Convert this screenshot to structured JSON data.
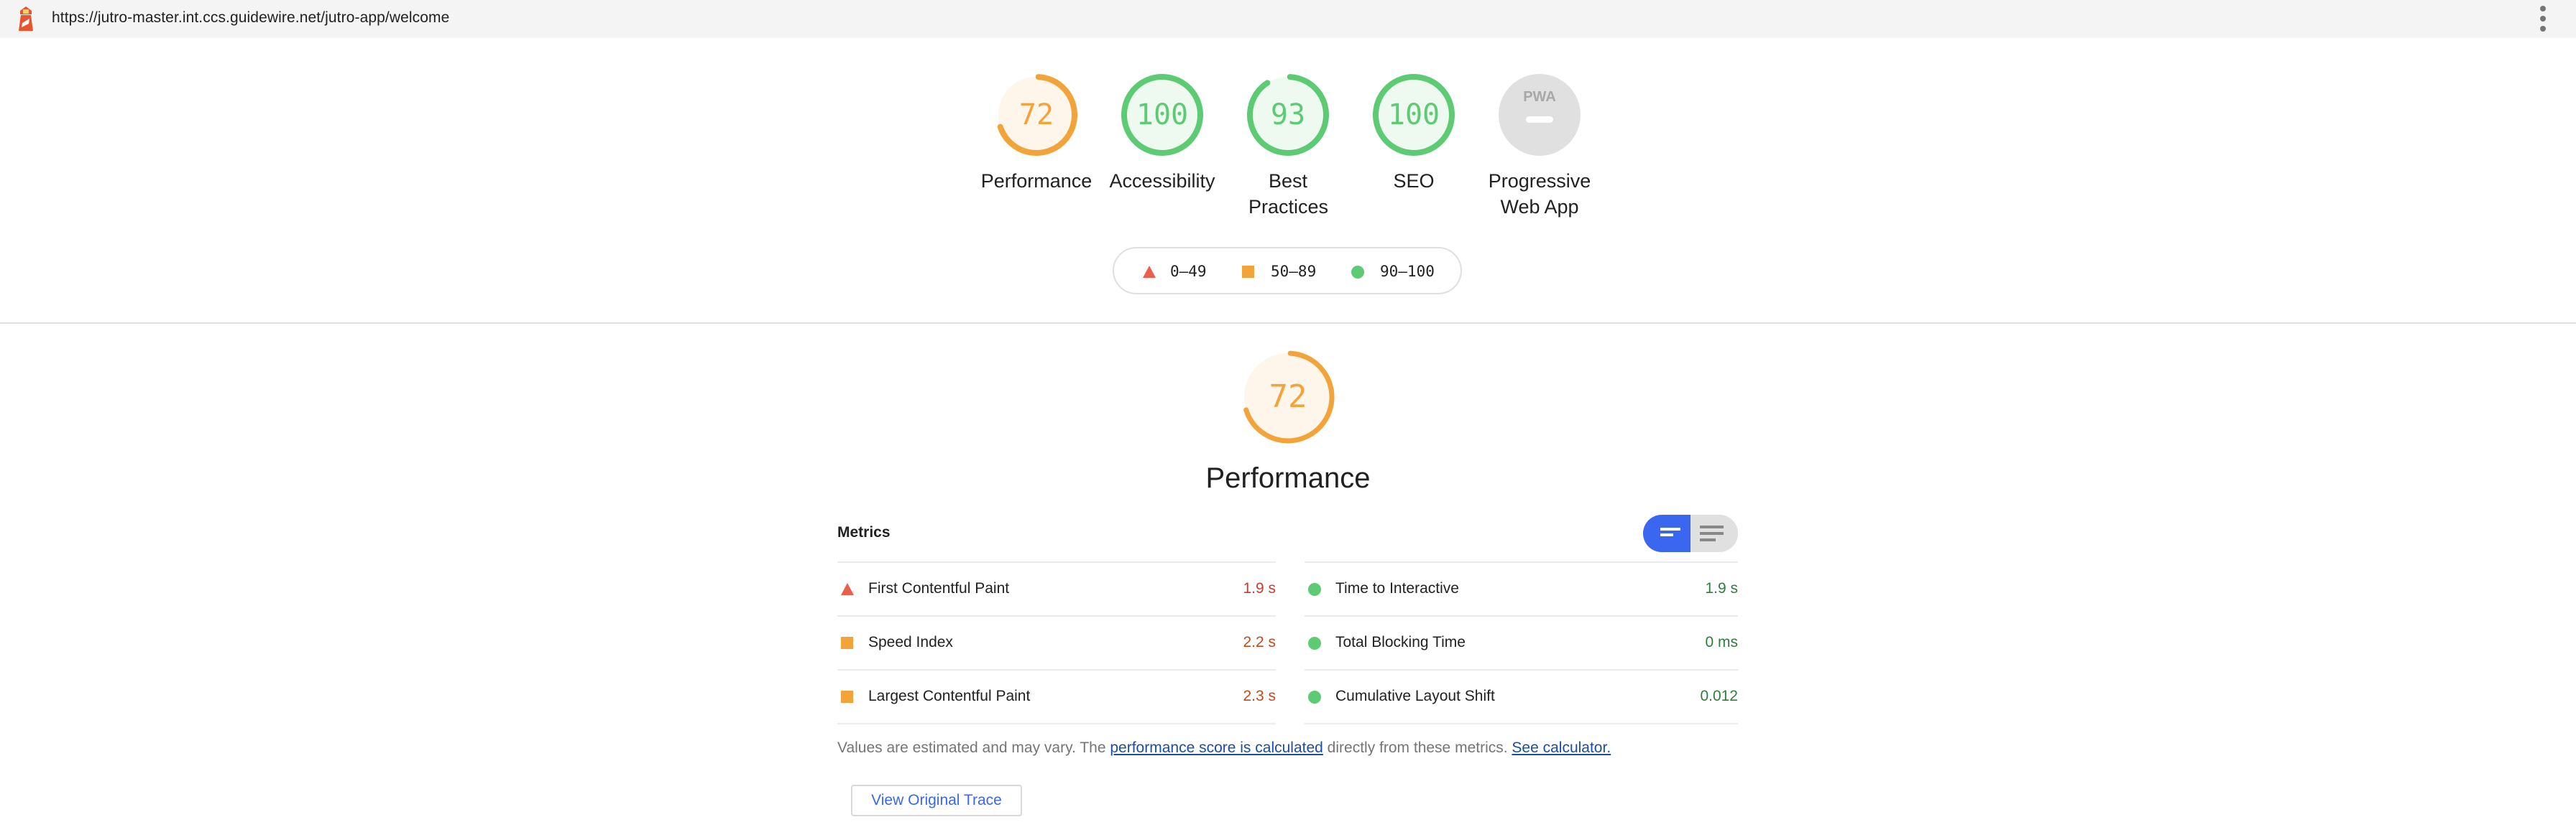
{
  "browser": {
    "url": "https://jutro-master.int.ccs.guidewire.net/jutro-app/welcome",
    "app_icon": "lighthouse-icon",
    "menu_icon": "kebab-menu-icon"
  },
  "colors": {
    "fail": "#eb5f4f",
    "average": "#f2a43a",
    "pass": "#5dcb74",
    "fail_text": "#cc3a2c",
    "average_text": "#c34a1c",
    "pass_text": "#2f7d3b",
    "toggle_active": "#3a66f0",
    "link": "#1a4da8"
  },
  "categories": [
    {
      "id": "performance",
      "label": "Performance",
      "score": "72",
      "rating": "average"
    },
    {
      "id": "accessibility",
      "label": "Accessibility",
      "score": "100",
      "rating": "pass"
    },
    {
      "id": "best-practices",
      "label": "Best Practices",
      "score": "93",
      "rating": "pass"
    },
    {
      "id": "seo",
      "label": "SEO",
      "score": "100",
      "rating": "pass"
    },
    {
      "id": "pwa",
      "label": "Progressive Web App",
      "score": "—",
      "rating": "na",
      "badge": "PWA"
    }
  ],
  "legend": [
    {
      "shape": "triangle",
      "label": "0–49"
    },
    {
      "shape": "square",
      "label": "50–89"
    },
    {
      "shape": "circle",
      "label": "90–100"
    }
  ],
  "section": {
    "title": "Performance",
    "score": "72",
    "metrics_heading": "Metrics",
    "toggle": {
      "active": "compact-view",
      "inactive": "expanded-view"
    }
  },
  "metrics": {
    "left": [
      {
        "name": "First Contentful Paint",
        "value": "1.9 s",
        "rating": "fail"
      },
      {
        "name": "Speed Index",
        "value": "2.2 s",
        "rating": "average"
      },
      {
        "name": "Largest Contentful Paint",
        "value": "2.3 s",
        "rating": "average"
      }
    ],
    "right": [
      {
        "name": "Time to Interactive",
        "value": "1.9 s",
        "rating": "pass"
      },
      {
        "name": "Total Blocking Time",
        "value": "0 ms",
        "rating": "pass"
      },
      {
        "name": "Cumulative Layout Shift",
        "value": "0.012",
        "rating": "pass"
      }
    ]
  },
  "note": {
    "prefix": "Values are estimated and may vary. The ",
    "link1": "performance score is calculated",
    "middle": " directly from these metrics. ",
    "link2": "See calculator."
  },
  "buttons": {
    "view_trace": "View Original Trace"
  }
}
